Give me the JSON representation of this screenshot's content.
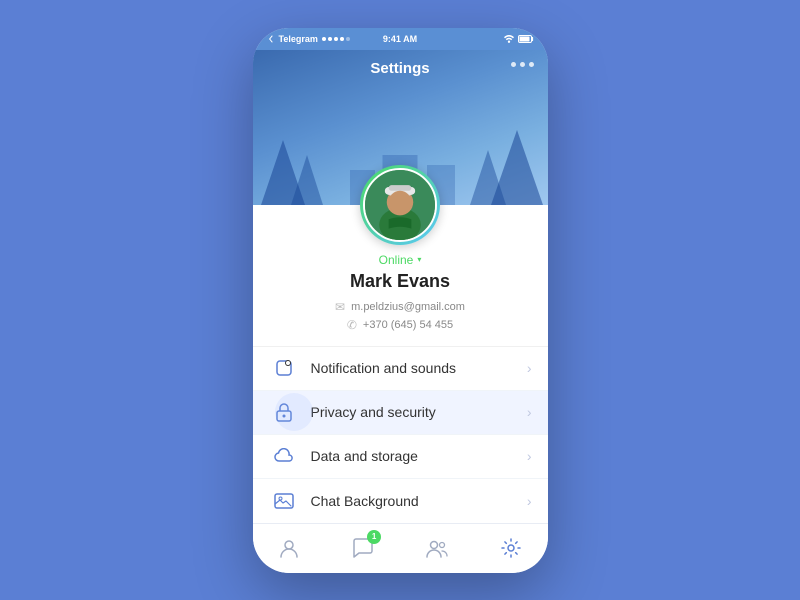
{
  "statusBar": {
    "carrier": "Telegram",
    "time": "9:41 AM",
    "signalDots": 5,
    "wifi": true,
    "battery": true
  },
  "header": {
    "title": "Settings",
    "dotsCount": 3
  },
  "profile": {
    "statusLabel": "Online",
    "name": "Mark Evans",
    "email": "m.peldzius@gmail.com",
    "phone": "+370 (645) 54 455"
  },
  "menuItems": [
    {
      "id": "notifications",
      "label": "Notification and sounds",
      "icon": "bell"
    },
    {
      "id": "privacy",
      "label": "Privacy and security",
      "icon": "lock",
      "active": true
    },
    {
      "id": "data",
      "label": "Data and storage",
      "icon": "cloud"
    },
    {
      "id": "background",
      "label": "Chat Background",
      "icon": "image"
    }
  ],
  "tabBar": {
    "tabs": [
      {
        "id": "profile",
        "label": "profile",
        "active": false
      },
      {
        "id": "messages",
        "label": "messages",
        "badge": "1",
        "active": false
      },
      {
        "id": "contacts",
        "label": "contacts",
        "active": false
      },
      {
        "id": "settings",
        "label": "settings",
        "active": true
      }
    ]
  }
}
